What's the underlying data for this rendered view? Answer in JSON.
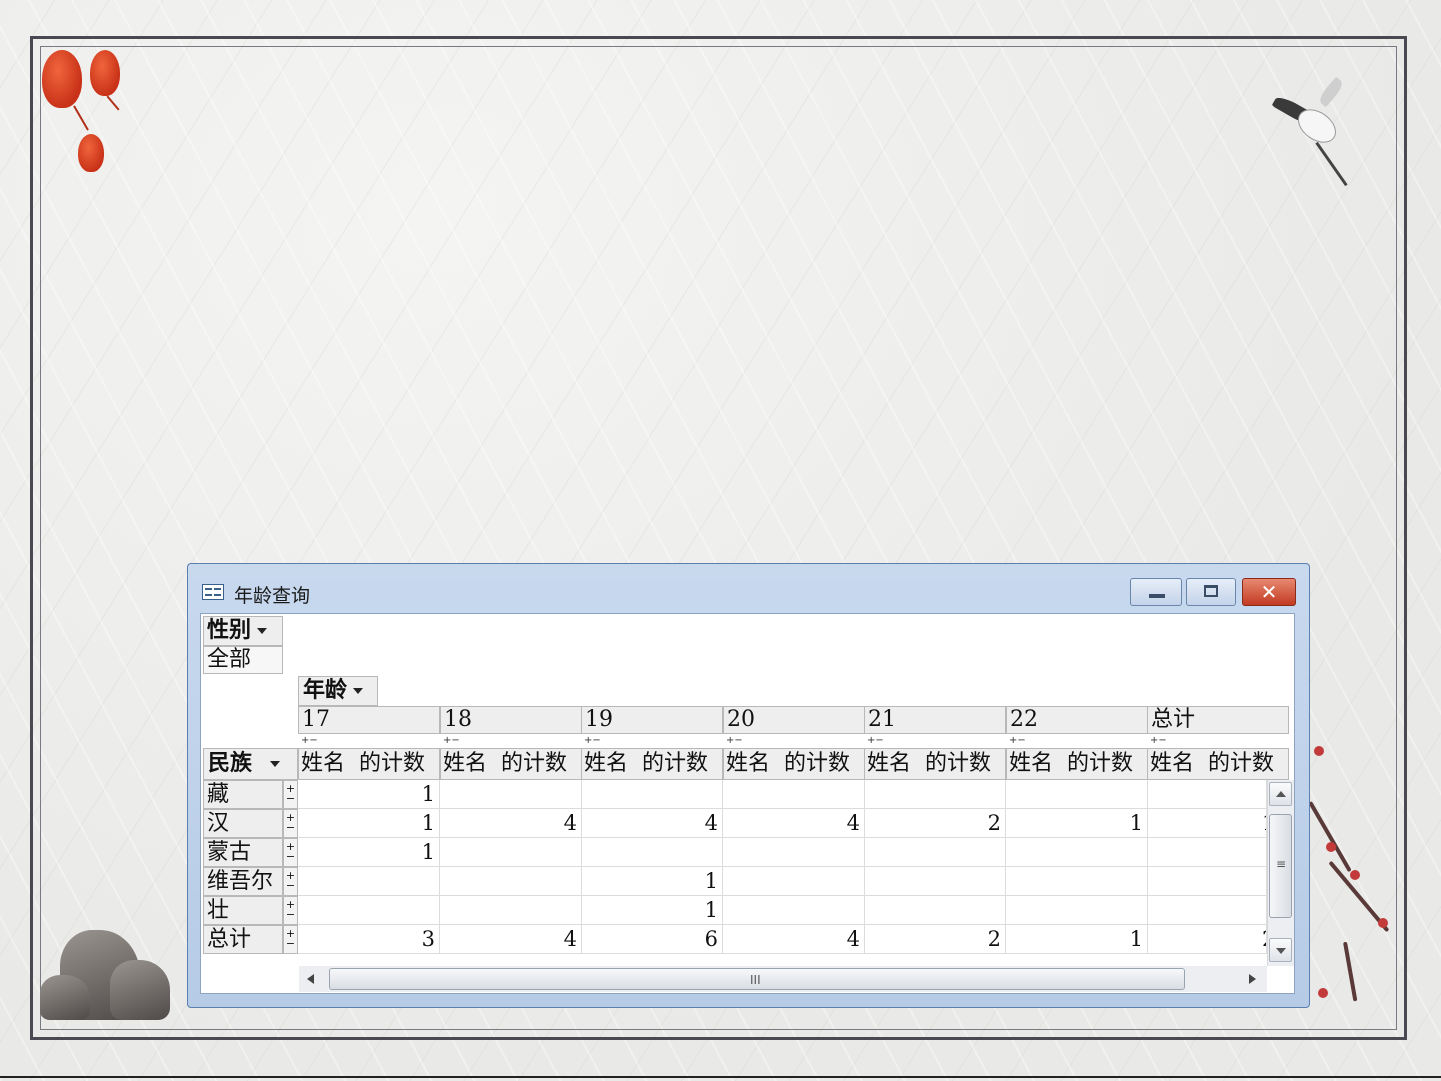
{
  "window": {
    "title": "年龄查询",
    "minimize_icon": "minimize-icon",
    "maximize_icon": "restore-icon",
    "close_icon": "close-icon",
    "close_color": "#c23b22"
  },
  "pivot": {
    "filter_field": "性别",
    "filter_value": "全部",
    "column_field": "年龄",
    "row_field": "民族",
    "columns": [
      {
        "header": "17",
        "measure_name": "姓名",
        "measure_label": "的计数"
      },
      {
        "header": "18",
        "measure_name": "姓名",
        "measure_label": "的计数"
      },
      {
        "header": "19",
        "measure_name": "姓名",
        "measure_label": "的计数"
      },
      {
        "header": "20",
        "measure_name": "姓名",
        "measure_label": "的计数"
      },
      {
        "header": "21",
        "measure_name": "姓名",
        "measure_label": "的计数"
      },
      {
        "header": "22",
        "measure_name": "姓名",
        "measure_label": "的计数"
      },
      {
        "header": "总计",
        "measure_name": "姓名",
        "measure_label": "的计数"
      }
    ],
    "rows": [
      {
        "label": "藏",
        "values": [
          "1",
          "",
          "",
          "",
          "",
          "",
          ""
        ]
      },
      {
        "label": "汉",
        "values": [
          "1",
          "4",
          "4",
          "4",
          "2",
          "1",
          "1"
        ]
      },
      {
        "label": "蒙古",
        "values": [
          "1",
          "",
          "",
          "",
          "",
          "",
          ""
        ]
      },
      {
        "label": "维吾尔",
        "values": [
          "",
          "",
          "1",
          "",
          "",
          "",
          ""
        ]
      },
      {
        "label": "壮",
        "values": [
          "",
          "",
          "1",
          "",
          "",
          "",
          ""
        ]
      },
      {
        "label": "总计",
        "values": [
          "3",
          "4",
          "6",
          "4",
          "2",
          "1",
          "2"
        ]
      }
    ],
    "expand_glyph": "+",
    "collapse_glyph": "−"
  },
  "scrollbar": {
    "h_thumb_grip": "III",
    "v_thumb_grip": "≡"
  }
}
